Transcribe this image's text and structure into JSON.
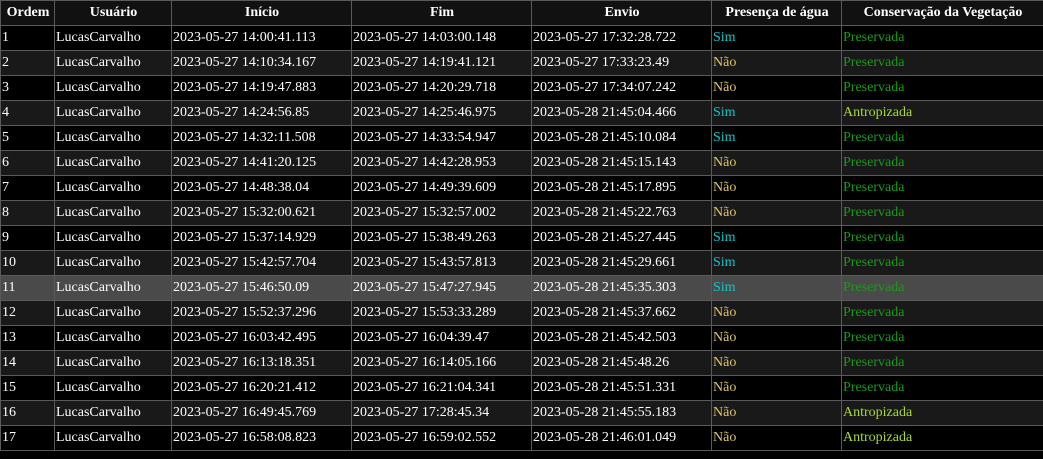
{
  "table": {
    "headers": [
      "Ordem",
      "Usuário",
      "Início",
      "Fim",
      "Envio",
      "Presença de água",
      "Conservação da Vegetação"
    ],
    "rows": [
      {
        "ordem": "1",
        "usuario": "LucasCarvalho",
        "inicio": "2023-05-27 14:00:41.113",
        "fim": "2023-05-27 14:03:00.148",
        "envio": "2023-05-27 17:32:28.722",
        "agua": "Sim",
        "vegetacao": "Preservada"
      },
      {
        "ordem": "2",
        "usuario": "LucasCarvalho",
        "inicio": "2023-05-27 14:10:34.167",
        "fim": "2023-05-27 14:19:41.121",
        "envio": "2023-05-27 17:33:23.49",
        "agua": "Não",
        "vegetacao": "Preservada"
      },
      {
        "ordem": "3",
        "usuario": "LucasCarvalho",
        "inicio": "2023-05-27 14:19:47.883",
        "fim": "2023-05-27 14:20:29.718",
        "envio": "2023-05-27 17:34:07.242",
        "agua": "Não",
        "vegetacao": "Preservada"
      },
      {
        "ordem": "4",
        "usuario": "LucasCarvalho",
        "inicio": "2023-05-27 14:24:56.85",
        "fim": "2023-05-27 14:25:46.975",
        "envio": "2023-05-28 21:45:04.466",
        "agua": "Sim",
        "vegetacao": "Antropizada"
      },
      {
        "ordem": "5",
        "usuario": "LucasCarvalho",
        "inicio": "2023-05-27 14:32:11.508",
        "fim": "2023-05-27 14:33:54.947",
        "envio": "2023-05-28 21:45:10.084",
        "agua": "Sim",
        "vegetacao": "Preservada"
      },
      {
        "ordem": "6",
        "usuario": "LucasCarvalho",
        "inicio": "2023-05-27 14:41:20.125",
        "fim": "2023-05-27 14:42:28.953",
        "envio": "2023-05-28 21:45:15.143",
        "agua": "Não",
        "vegetacao": "Preservada"
      },
      {
        "ordem": "7",
        "usuario": "LucasCarvalho",
        "inicio": "2023-05-27 14:48:38.04",
        "fim": "2023-05-27 14:49:39.609",
        "envio": "2023-05-28 21:45:17.895",
        "agua": "Não",
        "vegetacao": "Preservada"
      },
      {
        "ordem": "8",
        "usuario": "LucasCarvalho",
        "inicio": "2023-05-27 15:32:00.621",
        "fim": "2023-05-27 15:32:57.002",
        "envio": "2023-05-28 21:45:22.763",
        "agua": "Não",
        "vegetacao": "Preservada"
      },
      {
        "ordem": "9",
        "usuario": "LucasCarvalho",
        "inicio": "2023-05-27 15:37:14.929",
        "fim": "2023-05-27 15:38:49.263",
        "envio": "2023-05-28 21:45:27.445",
        "agua": "Sim",
        "vegetacao": "Preservada"
      },
      {
        "ordem": "10",
        "usuario": "LucasCarvalho",
        "inicio": "2023-05-27 15:42:57.704",
        "fim": "2023-05-27 15:43:57.813",
        "envio": "2023-05-28 21:45:29.661",
        "agua": "Sim",
        "vegetacao": "Preservada"
      },
      {
        "ordem": "11",
        "usuario": "LucasCarvalho",
        "inicio": "2023-05-27 15:46:50.09",
        "fim": "2023-05-27 15:47:27.945",
        "envio": "2023-05-28 21:45:35.303",
        "agua": "Sim",
        "vegetacao": "Preservada"
      },
      {
        "ordem": "12",
        "usuario": "LucasCarvalho",
        "inicio": "2023-05-27 15:52:37.296",
        "fim": "2023-05-27 15:53:33.289",
        "envio": "2023-05-28 21:45:37.662",
        "agua": "Não",
        "vegetacao": "Preservada"
      },
      {
        "ordem": "13",
        "usuario": "LucasCarvalho",
        "inicio": "2023-05-27 16:03:42.495",
        "fim": "2023-05-27 16:04:39.47",
        "envio": "2023-05-28 21:45:42.503",
        "agua": "Não",
        "vegetacao": "Preservada"
      },
      {
        "ordem": "14",
        "usuario": "LucasCarvalho",
        "inicio": "2023-05-27 16:13:18.351",
        "fim": "2023-05-27 16:14:05.166",
        "envio": "2023-05-28 21:45:48.26",
        "agua": "Não",
        "vegetacao": "Preservada"
      },
      {
        "ordem": "15",
        "usuario": "LucasCarvalho",
        "inicio": "2023-05-27 16:20:21.412",
        "fim": "2023-05-27 16:21:04.341",
        "envio": "2023-05-28 21:45:51.331",
        "agua": "Não",
        "vegetacao": "Preservada"
      },
      {
        "ordem": "16",
        "usuario": "LucasCarvalho",
        "inicio": "2023-05-27 16:49:45.769",
        "fim": "2023-05-27 17:28:45.34",
        "envio": "2023-05-28 21:45:55.183",
        "agua": "Não",
        "vegetacao": "Antropizada"
      },
      {
        "ordem": "17",
        "usuario": "LucasCarvalho",
        "inicio": "2023-05-27 16:58:08.823",
        "fim": "2023-05-27 16:59:02.552",
        "envio": "2023-05-28 21:46:01.049",
        "agua": "Não",
        "vegetacao": "Antropizada"
      }
    ],
    "highlighted_row": "11"
  },
  "colors": {
    "agua_sim": "#17c3c7",
    "agua_nao": "#d9c56c",
    "vegetacao_preservada": "#1a9a1a",
    "vegetacao_antropizada": "#a6d83a",
    "row_highlight": "#4a4a4a"
  }
}
